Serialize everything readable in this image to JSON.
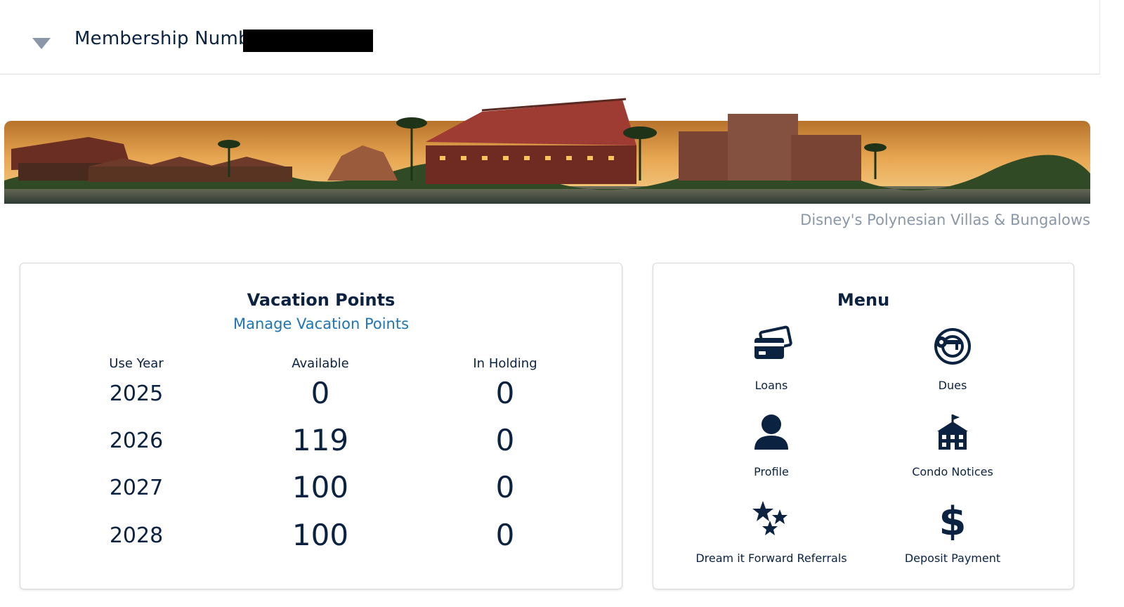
{
  "header": {
    "membership_label": "Membership Number:"
  },
  "banner": {
    "caption": "Disney's Polynesian Villas & Bungalows"
  },
  "points": {
    "title": "Vacation Points",
    "manage_link": "Manage Vacation Points",
    "columns": [
      "Use Year",
      "Available",
      "In Holding"
    ],
    "rows": [
      {
        "year": "2025",
        "available": "0",
        "holding": "0"
      },
      {
        "year": "2026",
        "available": "119",
        "holding": "0"
      },
      {
        "year": "2027",
        "available": "100",
        "holding": "0"
      },
      {
        "year": "2028",
        "available": "100",
        "holding": "0"
      }
    ]
  },
  "menu": {
    "title": "Menu",
    "items": [
      {
        "label": "Loans",
        "icon": "credit-card-icon"
      },
      {
        "label": "Dues",
        "icon": "key-wifi-icon"
      },
      {
        "label": "Profile",
        "icon": "person-icon"
      },
      {
        "label": "Condo Notices",
        "icon": "building-icon"
      },
      {
        "label": "Dream it Forward Referrals",
        "icon": "stars-icon"
      },
      {
        "label": "Deposit Payment",
        "icon": "dollar-icon"
      }
    ]
  },
  "colors": {
    "navy": "#0b2240",
    "link": "#1f75b5",
    "caption": "#8a97a8"
  }
}
